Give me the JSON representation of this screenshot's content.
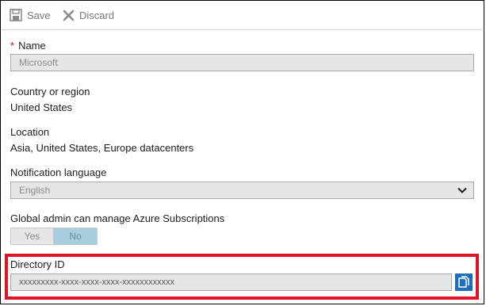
{
  "toolbar": {
    "save_label": "Save",
    "discard_label": "Discard"
  },
  "fields": {
    "name": {
      "required_marker": "*",
      "label": "Name",
      "value": "Microsoft"
    },
    "country": {
      "label": "Country or region",
      "value": "United States"
    },
    "location": {
      "label": "Location",
      "value": "Asia, United States, Europe datacenters"
    },
    "notification_language": {
      "label": "Notification language",
      "value": "English"
    },
    "global_admin": {
      "label": "Global admin can manage Azure Subscriptions",
      "options": [
        "Yes",
        "No"
      ],
      "selected": "No"
    },
    "directory_id": {
      "label": "Directory ID",
      "value": "xxxxxxxxx-xxxx-xxxx-xxxx-xxxxxxxxxxxx"
    }
  },
  "icons": {
    "save": "save-icon",
    "discard": "close-icon",
    "dropdown": "chevron-down-icon",
    "copy": "copy-icon"
  },
  "colors": {
    "highlight": "#e01426",
    "toggle_selected": "#a5cfdd",
    "copy_button": "#1e6fb8",
    "required": "#e00000"
  }
}
